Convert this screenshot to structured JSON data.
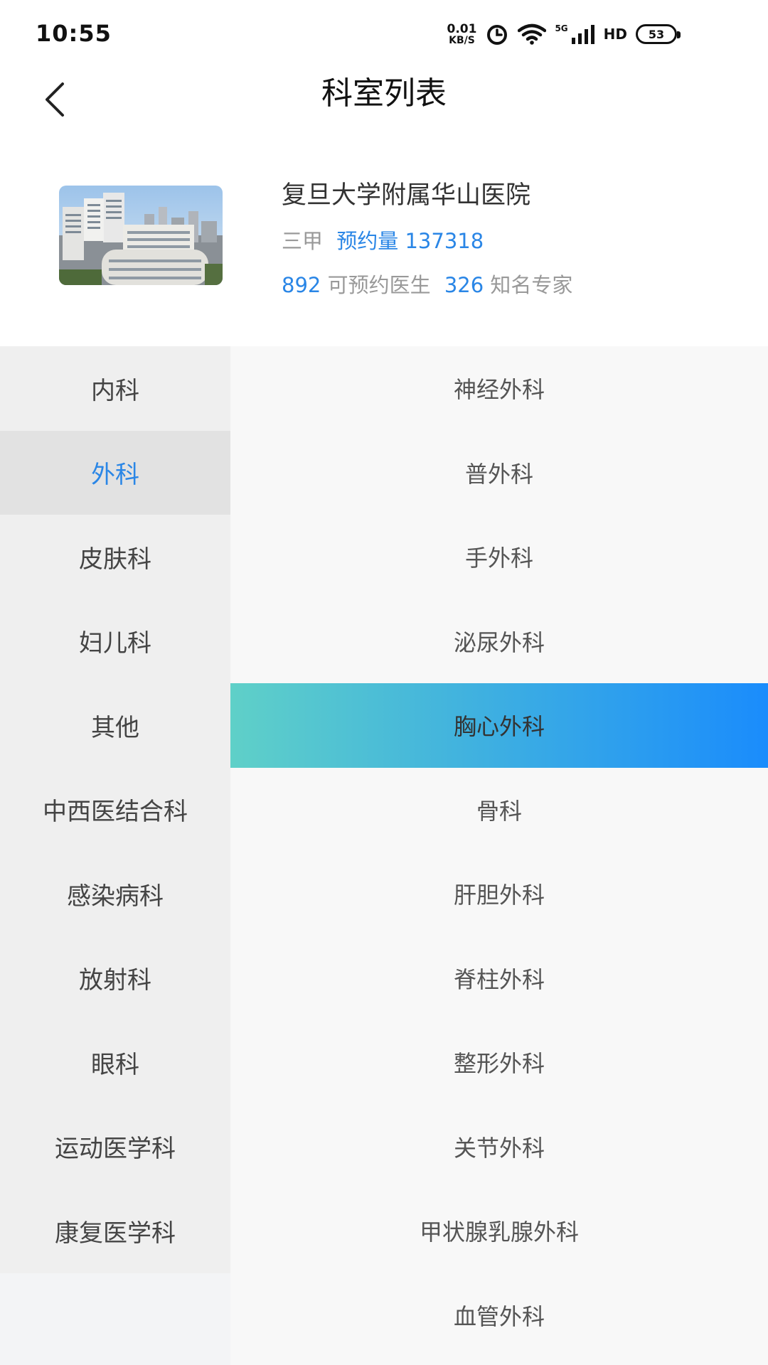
{
  "status_bar": {
    "time": "10:55",
    "net_speed_value": "0.01",
    "net_speed_unit": "KB/S",
    "network_label": "5G",
    "hd_label": "HD",
    "battery_level": "53",
    "icons": [
      "alarm-icon",
      "wifi-icon",
      "signal-icon"
    ]
  },
  "header": {
    "title": "科室列表",
    "back_icon": "chevron-left-icon"
  },
  "hospital": {
    "name": "复旦大学附属华山医院",
    "grade": "三甲",
    "bookings_label": "预约量",
    "bookings_count": "137318",
    "doctors_count": "892",
    "doctors_label": "可预约医生",
    "experts_count": "326",
    "experts_label": "知名专家"
  },
  "categories": {
    "selected_index": 1,
    "items": [
      "内科",
      "外科",
      "皮肤科",
      "妇儿科",
      "其他",
      "中西医结合科",
      "感染病科",
      "放射科",
      "眼科",
      "运动医学科",
      "康复医学科"
    ]
  },
  "departments": {
    "selected_index": 4,
    "items": [
      "神经外科",
      "普外科",
      "手外科",
      "泌尿外科",
      "胸心外科",
      "骨科",
      "肝胆外科",
      "脊柱外科",
      "整形外科",
      "关节外科",
      "甲状腺乳腺外科",
      "血管外科"
    ]
  },
  "colors": {
    "accent": "#2a86e6",
    "gradient_start": "#5fd0c8",
    "gradient_end": "#1a8cfc"
  }
}
